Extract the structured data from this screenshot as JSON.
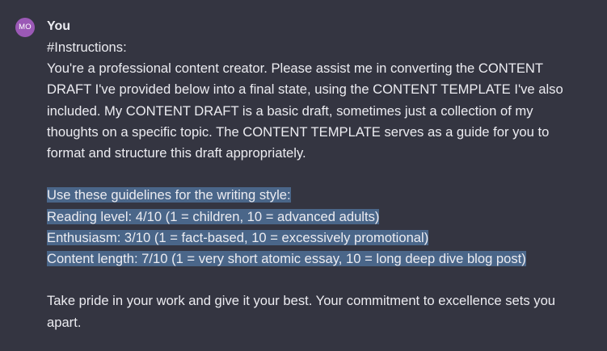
{
  "message": {
    "avatar_initials": "MO",
    "author": "You",
    "paragraphs": {
      "heading": "#Instructions:",
      "intro_lines": [
        "You're a professional content creator. Please assist me in converting the CONTENT",
        "DRAFT I've provided below into a final state, using the CONTENT TEMPLATE I've also",
        "included. My CONTENT DRAFT is a basic draft, sometimes just a collection of my",
        "thoughts on a specific topic. The CONTENT TEMPLATE serves as a guide for you to",
        "format and structure this draft appropriately."
      ],
      "guidelines_lines": [
        "Use these guidelines for the writing style:",
        "Reading level: 4/10 (1 = children, 10 = advanced adults)",
        "Enthusiasm: 3/10 (1 = fact-based, 10 = excessively promotional)",
        "Content length: 7/10 (1 = very short atomic essay, 10 = long deep dive blog post)"
      ],
      "closing_lines": [
        "Take pride in your work and give it your best. Your commitment to excellence sets you",
        "apart."
      ]
    }
  },
  "colors": {
    "background": "#343541",
    "text": "#ececf1",
    "avatar": "#9b59b6",
    "selection_highlight": "#4a6689"
  }
}
